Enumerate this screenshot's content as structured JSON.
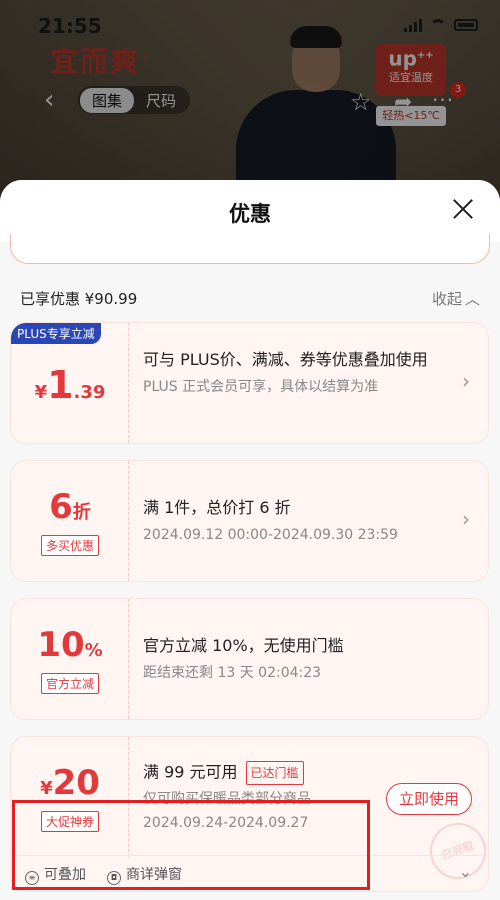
{
  "status_bar": {
    "time": "21:55"
  },
  "product": {
    "brand": "宜而爽",
    "brand_mark": "®",
    "tabs": [
      "图集",
      "尺码"
    ],
    "active_tab": 0,
    "badge_up": "up",
    "badge_up_sup": "++",
    "badge_desc": "适宜温度",
    "badge_temp": "轻热<15℃",
    "notification_count": "3"
  },
  "sheet": {
    "title": "优惠",
    "summary": "已享优惠 ¥90.99",
    "collapse_label": "收起",
    "coupons": [
      {
        "tag": "PLUS专享立减",
        "symbol": "¥",
        "amount_int": "1",
        "amount_dec": ".39",
        "title": "可与 PLUS价、满减、券等优惠叠加使用",
        "sub": "PLUS 正式会员可享，具体以结算为准"
      },
      {
        "amount_int": "6",
        "amount_unit": "折",
        "label": "多买优惠",
        "title": "满 1件，总价打 6 折",
        "sub": "2024.09.12 00:00-2024.09.30 23:59"
      },
      {
        "amount_int": "10",
        "amount_unit": "%",
        "label": "官方立减",
        "title": "官方立减 10%，无使用门槛",
        "sub": "距结束还剩 13 天 02:04:23"
      },
      {
        "symbol": "¥",
        "amount_int": "20",
        "label": "大促神券",
        "title": "满 99 元可用",
        "threshold": "已达门槛",
        "sub1": "仅可购买保暖品类部分商品",
        "sub2": "2024.09.24-2024.09.27",
        "button": "立即使用",
        "stamp": "已领取",
        "footer_stackable": "可叠加",
        "footer_popup": "商详弹窗"
      }
    ]
  },
  "colors": {
    "accent": "#e4393c",
    "plus": "#2a47b5",
    "highlight": "#e02020"
  }
}
